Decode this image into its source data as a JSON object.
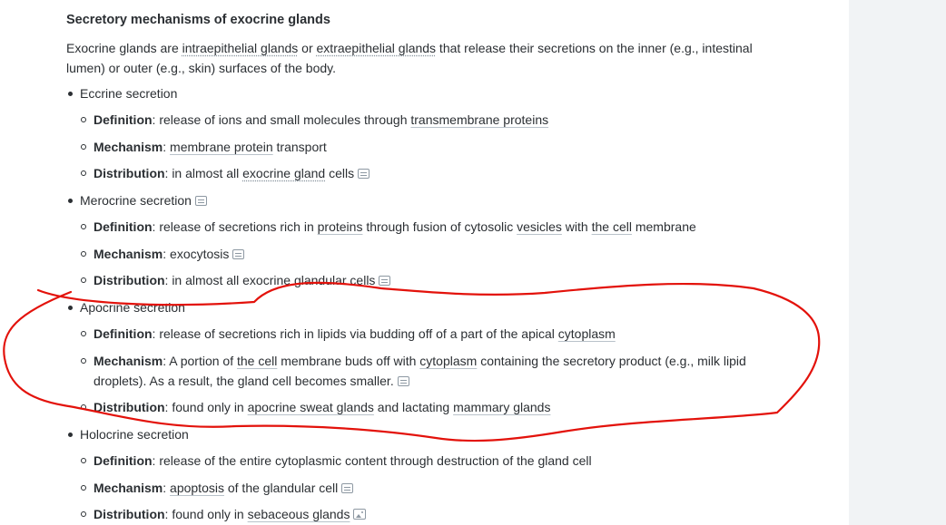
{
  "article": {
    "title": "Secretory mechanisms of exocrine glands",
    "intro": {
      "p1": "Exocrine glands are ",
      "link1": "intraepithelial glands",
      "p2": " or ",
      "link2": "extraepithelial glands",
      "p3": " that release their secretions on the inner (e.g., intestinal lumen) or outer (e.g., skin) surfaces of the body."
    },
    "sections": {
      "eccrine": {
        "heading": "Eccrine secretion",
        "definition": {
          "label": "Definition",
          "t1": ": release of ions and small molecules through ",
          "l1": "transmembrane proteins"
        },
        "mechanism": {
          "label": "Mechanism",
          "t1": ": ",
          "l1": "membrane protein",
          "t2": " transport"
        },
        "distribution": {
          "label": "Distribution",
          "t1": ": in almost all ",
          "l1": "exocrine gland",
          "t2": " cells"
        }
      },
      "merocrine": {
        "heading": "Merocrine secretion",
        "definition": {
          "label": "Definition",
          "t1": ": release of secretions rich in ",
          "l1": "proteins",
          "t2": " through fusion of cytosolic ",
          "l2": "vesicles",
          "t3": " with ",
          "l3": "the cell",
          "t4": " membrane"
        },
        "mechanism": {
          "label": "Mechanism",
          "t1": ": exocytosis"
        },
        "distribution": {
          "label": "Distribution",
          "t1": ": in almost all exocrine glandular cells"
        }
      },
      "apocrine": {
        "heading": "Apocrine secretion",
        "definition": {
          "label": "Definition",
          "t1": ": release of secretions rich in lipids via budding off of a part of the apical ",
          "l1": "cytoplasm"
        },
        "mechanism": {
          "label": "Mechanism",
          "t1": ": A portion of ",
          "l1": "the cell",
          "t2": " membrane buds off with ",
          "l2": "cytoplasm",
          "t3": " containing the secretory product (e.g., milk lipid droplets). As a result, the gland cell becomes smaller."
        },
        "distribution": {
          "label": "Distribution",
          "t1": ": found only in ",
          "l1": "apocrine sweat glands",
          "t2": " and lactating ",
          "l2": "mammary glands"
        }
      },
      "holocrine": {
        "heading": "Holocrine secretion",
        "definition": {
          "label": "Definition",
          "t1": ": release of the entire cytoplasmic content through destruction of the gland cell"
        },
        "mechanism": {
          "label": "Mechanism",
          "t1": ": ",
          "l1": "apoptosis",
          "t2": " of the glandular cell"
        },
        "distribution": {
          "label": "Distribution",
          "t1": ": found only in ",
          "l1": "sebaceous glands"
        }
      }
    }
  },
  "annotation": {
    "color": "#e3120b"
  },
  "icons": {
    "note": "note-icon",
    "image": "image-icon"
  },
  "colors": {
    "text": "#2b2f33",
    "sidepanel": "#f1f3f5",
    "link_underline": "#b9c2ca"
  }
}
